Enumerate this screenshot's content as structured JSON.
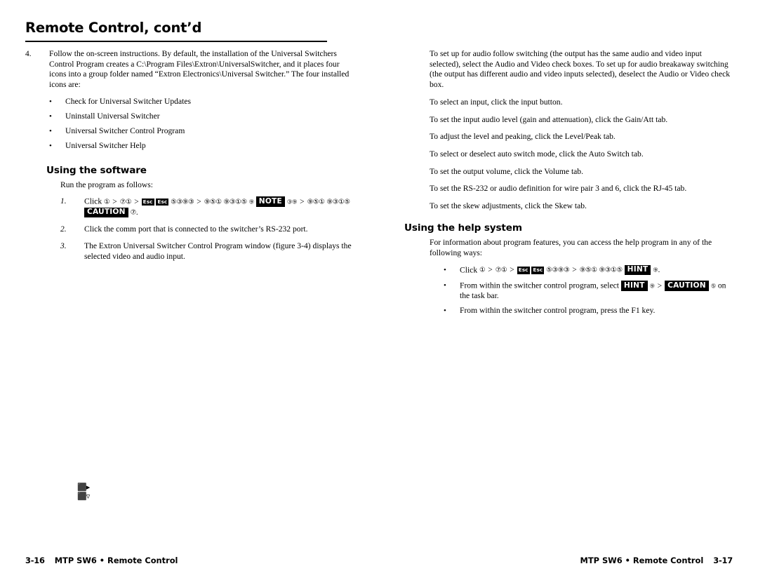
{
  "spread": {
    "left_page": {
      "title": "Remote Control, cont’d",
      "step4": {
        "number": "4.",
        "text": "Follow the on-screen instructions.  By default, the installation of the Universal Switchers Control Program creates a C:\\Program Files\\Extron\\UniversalSwitcher, and it places four icons into a group folder named “Extron Electronics\\Universal Switcher.”  The four installed icons are:"
      },
      "installed_icons": [
        "Check for Universal Switcher Updates",
        "Uninstall Universal Switcher",
        "Universal Switcher Control Program",
        "Universal Switcher Help"
      ],
      "software_section": {
        "heading": "Using the software",
        "intro": "Run the program as follows:",
        "steps": [
          {
            "number": "1.",
            "lead": "Click",
            "tokens": [
              {
                "type": "dingbat",
                "text": "①"
              },
              {
                "type": "gt",
                "text": ">"
              },
              {
                "type": "dingbat",
                "text": "⑦①"
              },
              {
                "type": "gt",
                "text": ">"
              },
              {
                "type": "keycap",
                "text": "Esc"
              },
              {
                "type": "keycap",
                "text": "Esc"
              },
              {
                "type": "dingbat",
                "text": "⑤③⑨③"
              },
              {
                "type": "gt",
                "text": ">"
              },
              {
                "type": "dingbat",
                "text": "⑨⑤①"
              },
              {
                "type": "dingbat",
                "text": "⑨③①⑤"
              },
              {
                "type": "dingbat-small",
                "text": "⑨"
              },
              {
                "type": "badge",
                "text": "NOTE"
              },
              {
                "type": "dingbat-small",
                "text": "③⑨"
              },
              {
                "type": "gt",
                "text": ">"
              },
              {
                "type": "dingbat",
                "text": "⑨⑤①"
              },
              {
                "type": "dingbat",
                "text": "⑨③①⑤"
              },
              {
                "type": "badge",
                "text": "CAUTION"
              },
              {
                "type": "dingbat",
                "text": "⑦"
              },
              {
                "type": "text",
                "text": "."
              }
            ]
          },
          {
            "number": "2.",
            "text": "Click the comm port that is connected to the switcher’s RS-232 port."
          },
          {
            "number": "3.",
            "text": "The Extron Universal Switcher Control Program window (figure 3-4) displays the selected video and audio input."
          }
        ]
      },
      "stray_glyphs": "⬛▸\n⬛▿",
      "footer": {
        "folio": "3-16",
        "running_head": "MTP SW6 • Remote Control"
      }
    },
    "right_page": {
      "paragraphs": [
        "To set up for audio follow switching (the output has the same audio and video input selected), select the Audio and Video check boxes.  To set up for audio breakaway switching (the output has different audio and video inputs selected), deselect the Audio or Video check box.",
        "To select an input, click the input button.",
        "To set the input audio level (gain and attenuation), click the Gain/Att tab.",
        "To adjust the level and peaking, click the Level/Peak tab.",
        "To select or deselect auto switch mode, click the Auto Switch tab.",
        "To set the output volume, click the Volume tab.",
        "To set the RS-232 or audio definition for wire pair 3 and 6, click the RJ-45 tab.",
        "To set the skew adjustments, click the Skew tab."
      ],
      "help_section": {
        "heading": "Using the help system",
        "intro": "For information about program features, you can access the help program in any of the following ways:",
        "bullets": [
          {
            "lead": "Click",
            "tokens": [
              {
                "type": "dingbat",
                "text": "①"
              },
              {
                "type": "gt",
                "text": ">"
              },
              {
                "type": "dingbat",
                "text": "⑦①"
              },
              {
                "type": "gt",
                "text": ">"
              },
              {
                "type": "keycap",
                "text": "Esc"
              },
              {
                "type": "keycap",
                "text": "Esc"
              },
              {
                "type": "dingbat",
                "text": "⑤③⑨③"
              },
              {
                "type": "gt",
                "text": ">"
              },
              {
                "type": "dingbat",
                "text": "⑨⑤①"
              },
              {
                "type": "dingbat",
                "text": "⑨③①⑤"
              },
              {
                "type": "badge",
                "text": "HINT"
              },
              {
                "type": "dingbat-small",
                "text": "⑨"
              },
              {
                "type": "text",
                "text": "."
              }
            ]
          },
          {
            "text_before": "From within the switcher control program, select",
            "tokens": [
              {
                "type": "badge",
                "text": "HINT"
              },
              {
                "type": "dingbat-small",
                "text": "⑨"
              },
              {
                "type": "gt",
                "text": ">"
              },
              {
                "type": "badge",
                "text": "CAUTION"
              },
              {
                "type": "dingbat-small",
                "text": "⑤"
              }
            ],
            "text_after": "on the task bar."
          },
          {
            "text": "From within the switcher control program, press the F1 key."
          }
        ]
      },
      "footer": {
        "running_head": "MTP SW6 • Remote Control",
        "folio": "3-17"
      }
    }
  },
  "bullet_char": "•",
  "colors": {
    "text": "#000000",
    "page_background": "#ffffff",
    "badge_background": "#000000",
    "badge_text": "#ffffff"
  }
}
